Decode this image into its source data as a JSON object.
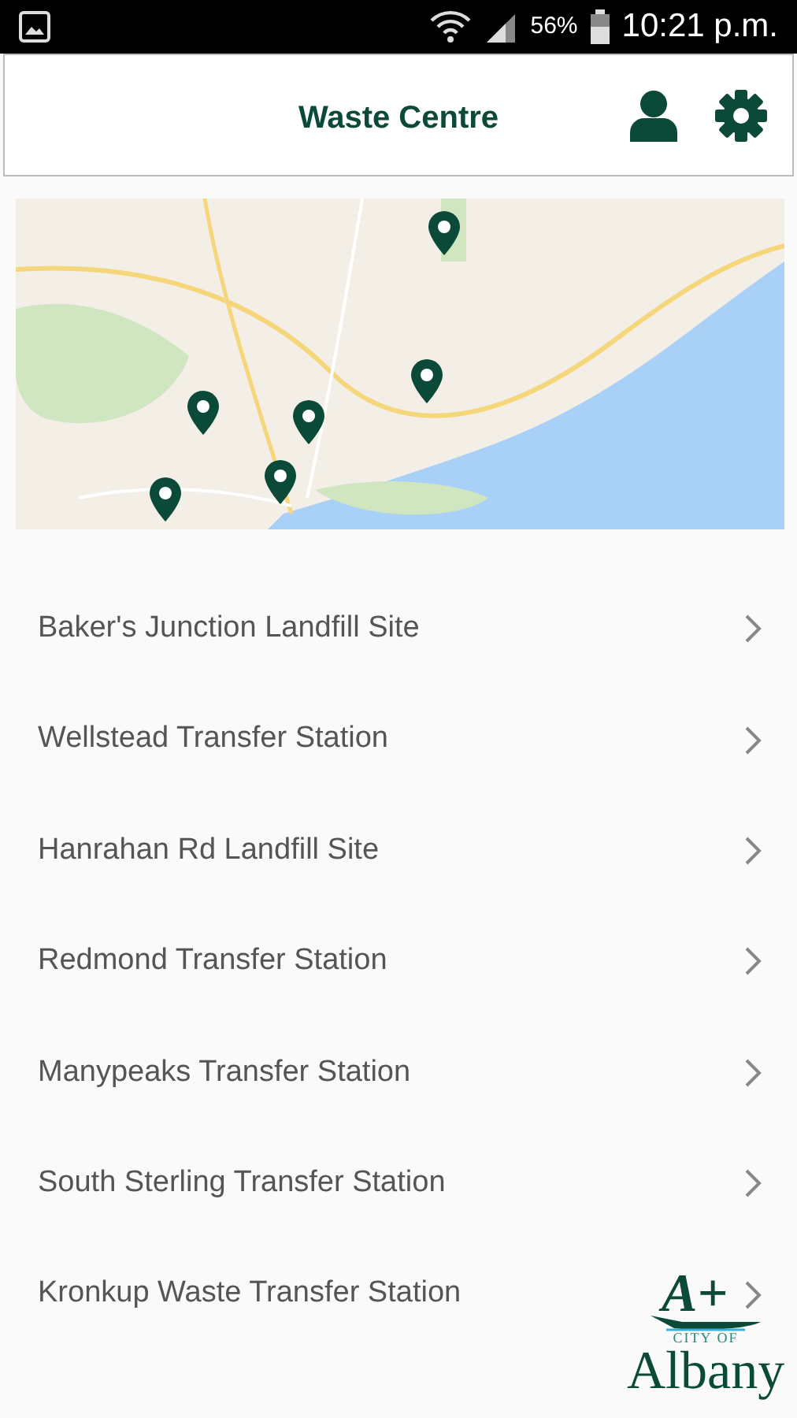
{
  "status_bar": {
    "battery": "56%",
    "time": "10:21 p.m."
  },
  "header": {
    "title": "Waste Centre"
  },
  "sites": [
    {
      "name": "Baker's Junction Landfill Site"
    },
    {
      "name": "Wellstead Transfer Station"
    },
    {
      "name": "Hanrahan Rd Landfill Site"
    },
    {
      "name": "Redmond Transfer Station"
    },
    {
      "name": "Manypeaks Transfer Station"
    },
    {
      "name": "South Sterling Transfer Station"
    },
    {
      "name": "Kronkup Waste Transfer Station"
    }
  ],
  "logo": {
    "mark": "A+",
    "tagline": "CITY OF",
    "name": "Albany"
  }
}
